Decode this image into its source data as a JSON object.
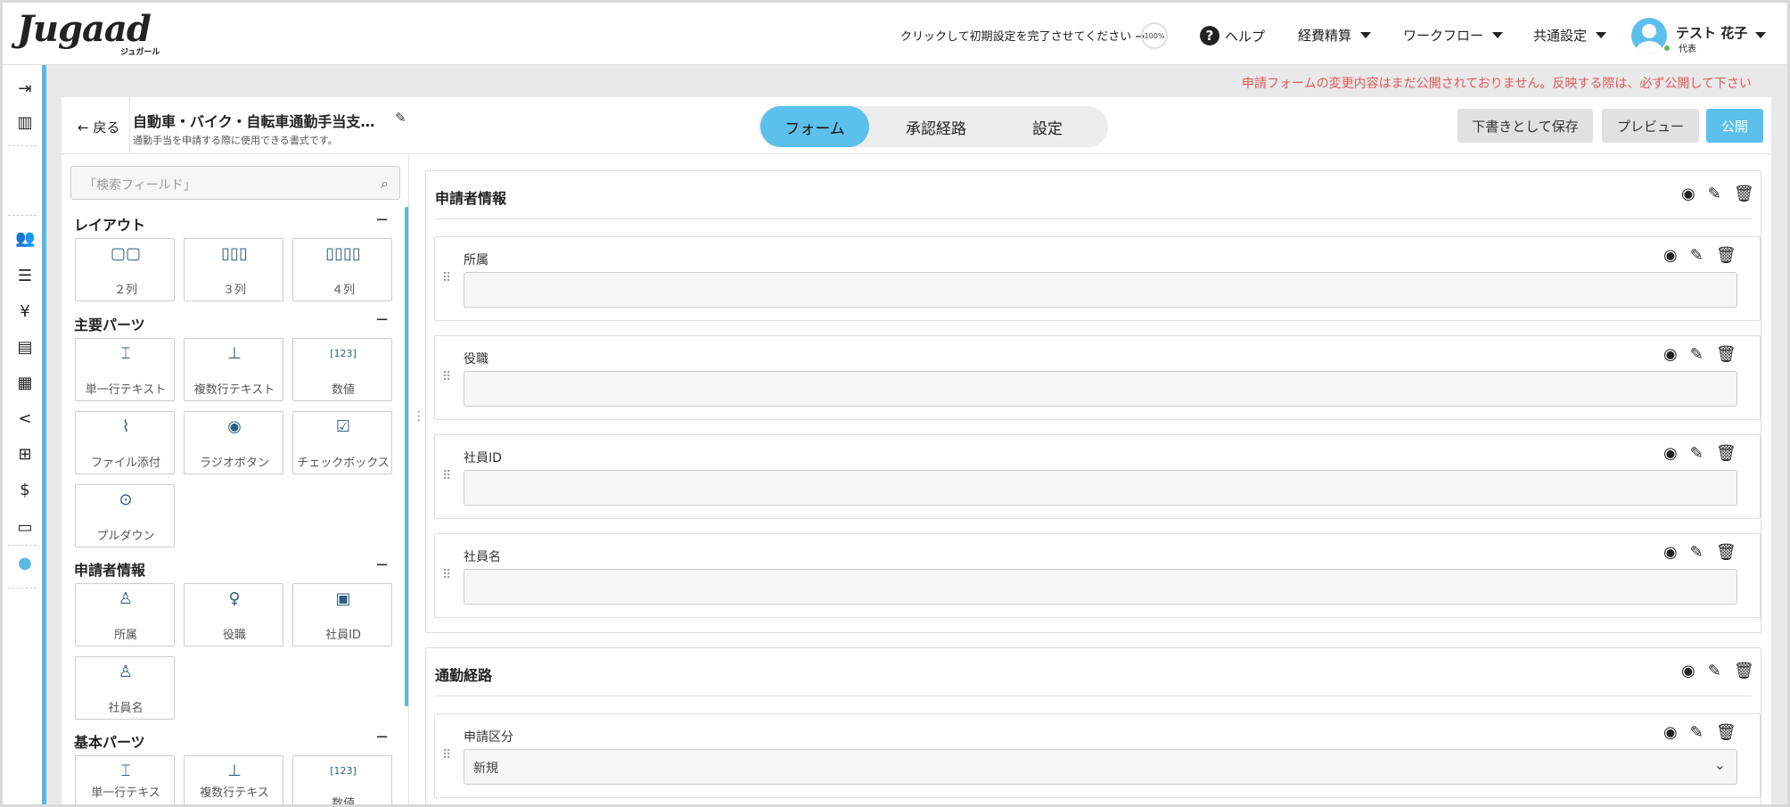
{
  "header": {
    "logo": "Jugaad",
    "logo_sub": "ジュガール",
    "setup_prompt": "クリックして初期設定を完了させてください →",
    "setup_progress": "100%",
    "help": "ヘルプ",
    "menu": [
      "経費精算",
      "ワークフロー",
      "共通設定"
    ],
    "user_name": "テスト 花子",
    "user_role": "代表"
  },
  "rail": {
    "icons": [
      "menu-expand-icon",
      "building-icon",
      "users-icon",
      "list-icon",
      "yen-icon",
      "receipt-icon",
      "book-icon",
      "share-icon",
      "table-icon",
      "dollar-doc-icon",
      "manual-icon",
      "palette-icon"
    ]
  },
  "notice": "申請フォームの変更内容はまだ公開されておりません。反映する際は、必ず公開して下さい",
  "topbar": {
    "back": "← 戻る",
    "form_title": "自動車・バイク・自転車通勤手当支…",
    "form_desc": "通勤手当を申請する際に使用できる書式です。",
    "tabs": [
      {
        "label": "フォーム",
        "active": true
      },
      {
        "label": "承認経路",
        "active": false
      },
      {
        "label": "設定",
        "active": false
      }
    ],
    "save_draft": "下書きとして保存",
    "preview": "プレビュー",
    "publish": "公開"
  },
  "palette": {
    "search_placeholder": "「検索フィールド」",
    "sections": [
      {
        "title": "レイアウト",
        "items": [
          "２列",
          "３列",
          "４列"
        ]
      },
      {
        "title": "主要パーツ",
        "items": [
          "単一行テキスト",
          "複数行テキスト",
          "数値",
          "ファイル添付",
          "ラジオボタン",
          "チェックボックス",
          "プルダウン"
        ]
      },
      {
        "title": "申請者情報",
        "items": [
          "所属",
          "役職",
          "社員ID",
          "社員名"
        ]
      },
      {
        "title": "基本パーツ",
        "items": [
          "単一行テキス",
          "複数行テキス",
          "数値"
        ]
      }
    ]
  },
  "canvas": {
    "groups": [
      {
        "title": "申請者情報",
        "fields": [
          "所属",
          "役職",
          "社員ID",
          "社員名"
        ]
      },
      {
        "title": "通勤経路",
        "fields": [
          {
            "label": "申請区分",
            "value": "新規"
          }
        ]
      }
    ]
  },
  "colors": {
    "accent": "#5bc0eb",
    "notice": "#e05a5a",
    "rail_accent": "#5bb8e6"
  }
}
